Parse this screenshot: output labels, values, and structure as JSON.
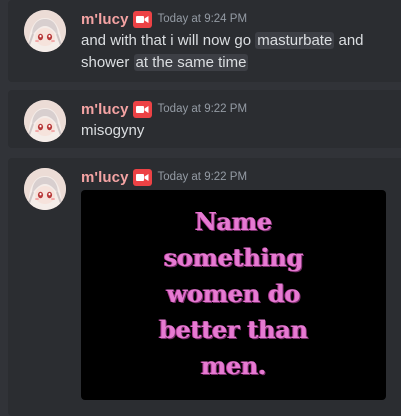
{
  "messages": [
    {
      "username": "m'lucy",
      "timestamp": "Today at 9:24 PM",
      "segments": [
        {
          "text": "and with that i will now go ",
          "spoiler": false
        },
        {
          "text": "masturbate",
          "spoiler": true
        },
        {
          "text": " and shower ",
          "spoiler": false
        },
        {
          "text": "at the same time",
          "spoiler": true
        }
      ]
    },
    {
      "username": "m'lucy",
      "timestamp": "Today at 9:22 PM",
      "text": "misogyny"
    },
    {
      "username": "m'lucy",
      "timestamp": "Today at 9:22 PM",
      "image_text_lines": [
        "Name",
        "something",
        "women do",
        "better than",
        "men."
      ]
    }
  ],
  "colors": {
    "background": "#313338",
    "message_bg": "#2b2d31",
    "username": "#f4a3a3",
    "timestamp": "#949ba4",
    "text": "#dbdee1",
    "badge": "#ed4245",
    "embed_text": "#e67ad2"
  },
  "icons": {
    "badge": "video-camera-icon"
  }
}
